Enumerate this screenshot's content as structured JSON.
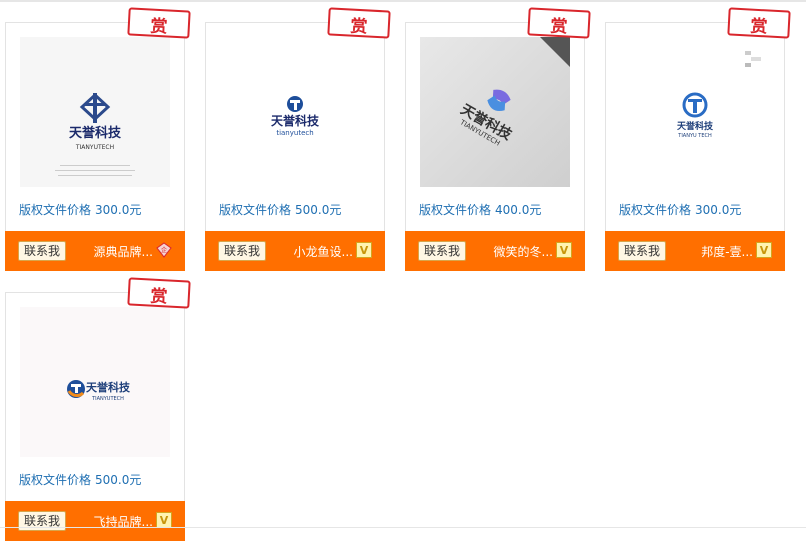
{
  "reward_label": "赏",
  "contact_label": "联系我",
  "price_label": "版权文件价格",
  "cards": [
    {
      "price": "300.0元",
      "shop": "源典品牌...",
      "badge": "diamond-badge-icon",
      "logo_cn": "天誉科技",
      "logo_en": "TIANYUTECH"
    },
    {
      "price": "500.0元",
      "shop": "小龙鱼设...",
      "badge": "v-badge-icon",
      "logo_cn": "天誉科技",
      "logo_en": "tianyutech"
    },
    {
      "price": "400.0元",
      "shop": "微笑的冬...",
      "badge": "v-badge-icon",
      "logo_cn": "天誉科技",
      "logo_en": "TIANYUTECH"
    },
    {
      "price": "300.0元",
      "shop": "邦度-壹...",
      "badge": "v-badge-icon",
      "logo_cn": "天誉科技",
      "logo_en": "TIANYU TECH"
    },
    {
      "price": "500.0元",
      "shop": "飞持品牌...",
      "badge": "v-badge-icon",
      "logo_cn": "天誉科技",
      "logo_en": "TIANYUTECH"
    }
  ],
  "colors": {
    "accent": "#ff6f00",
    "price": "#1f6fb2",
    "reward": "#d9262c"
  }
}
